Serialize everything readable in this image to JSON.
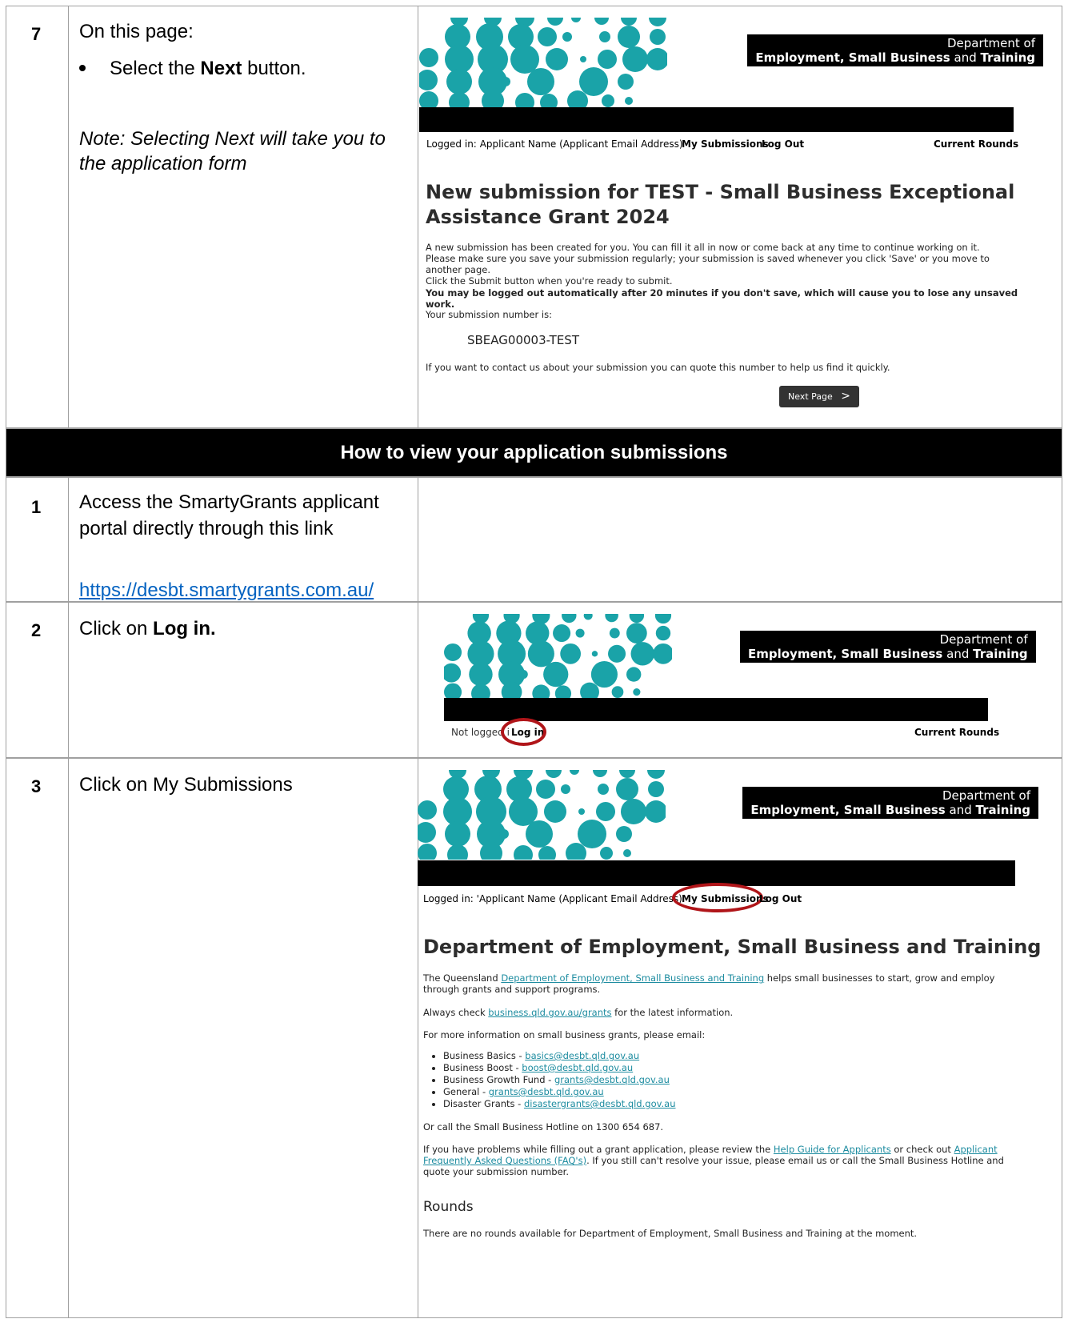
{
  "step7": {
    "number": "7",
    "intro": "On this page:",
    "bullet_prefix": "Select the ",
    "bullet_bold": "Next",
    "bullet_suffix": " button.",
    "note": "Note: Selecting Next will take you to the application form",
    "screenshot": {
      "dept_line1": "Department of",
      "dept_line2_bold": "Employment, Small Business",
      "dept_line2_mid": " and ",
      "dept_line2_end": "Training",
      "logged_in_label": "Logged in:",
      "user": "Applicant Name (Applicant Email Address)",
      "my_submissions": "My Submissions",
      "log_out": "Log Out",
      "current_rounds": "Current Rounds",
      "heading": "New submission for TEST - Small Business Exceptional Assistance Grant 2024",
      "para1": "A new submission has been created for you. You can fill it all in now or come back at any time to continue working on it.",
      "para2": "Please make sure you save your submission regularly; your submission is saved whenever you click 'Save' or you move to another page.",
      "para3": "Click the Submit button when you're ready to submit.",
      "warning": "You may be logged out automatically after 20 minutes if you don't save, which will cause you to lose any unsaved work.",
      "number_label": "Your submission number is:",
      "submission_number": "SBEAG00003-TEST",
      "contact_text": "If you want to contact us about your submission you can quote this number to help us find it quickly.",
      "next_label": "Next Page",
      "next_glyph": ">"
    }
  },
  "section": {
    "title": "How to view your application submissions"
  },
  "step1": {
    "number": "1",
    "text": "Access the SmartyGrants applicant portal directly through this link",
    "url": "https://desbt.smartygrants.com.au/"
  },
  "step2": {
    "number": "2",
    "text_prefix": "Click on ",
    "text_bold": "Log in.",
    "screenshot": {
      "dept_line1": "Department of",
      "dept_line2_bold": "Employment, Small Business",
      "dept_line2_mid": " and ",
      "dept_line2_end": "Training",
      "not_logged": "Not logged i",
      "log_in": "Log in",
      "current_rounds": "Current Rounds"
    }
  },
  "step3": {
    "number": "3",
    "text": "Click on My Submissions",
    "screenshot": {
      "dept_line1": "Department of",
      "dept_line2_bold": "Employment, Small Business",
      "dept_line2_mid": " and ",
      "dept_line2_end": "Training",
      "logged_in_label": "Logged in: '",
      "user": "Applicant Name (Applicant Email Address)",
      "my_submissions": "My Submissions",
      "log_out": "Log Out",
      "heading": "Department of Employment, Small Business and Training",
      "intro_prefix": "The Queensland ",
      "intro_link": "Department of Employment, Small Business and Training",
      "intro_suffix": " helps small businesses to start, grow and employ through grants and support programs.",
      "check_prefix": "Always check ",
      "check_link": "business.qld.gov.au/grants",
      "check_suffix": " for the latest information.",
      "email_intro": "For more information on small business grants, please email:",
      "emails": [
        {
          "label": "Business Basics - ",
          "email": "basics@desbt.qld.gov.au"
        },
        {
          "label": "Business Boost - ",
          "email": "boost@desbt.qld.gov.au"
        },
        {
          "label": "Business Growth Fund - ",
          "email": "grants@desbt.qld.gov.au"
        },
        {
          "label": "General - ",
          "email": "grants@desbt.qld.gov.au"
        },
        {
          "label": "Disaster Grants - ",
          "email": "disastergrants@desbt.qld.gov.au"
        }
      ],
      "hotline": "Or call the Small Business Hotline on 1300 654 687.",
      "help_prefix": "If you have problems while filling out a grant application, please review the ",
      "help_link1": "Help Guide for Applicants",
      "help_mid": " or check out ",
      "help_link2": "Applicant Frequently Asked Questions (FAQ's)",
      "help_suffix": ". If you still can't resolve your issue, please email us or call the Small Business Hotline and quote your submission number.",
      "rounds_heading": "Rounds",
      "rounds_text": "There are no rounds available for Department of Employment, Small Business and Training at the moment."
    }
  },
  "colors": {
    "dot": "#1aa3a8",
    "ring": "#b01519",
    "link": "#0563c1",
    "portal_link": "#1d8ca0"
  }
}
